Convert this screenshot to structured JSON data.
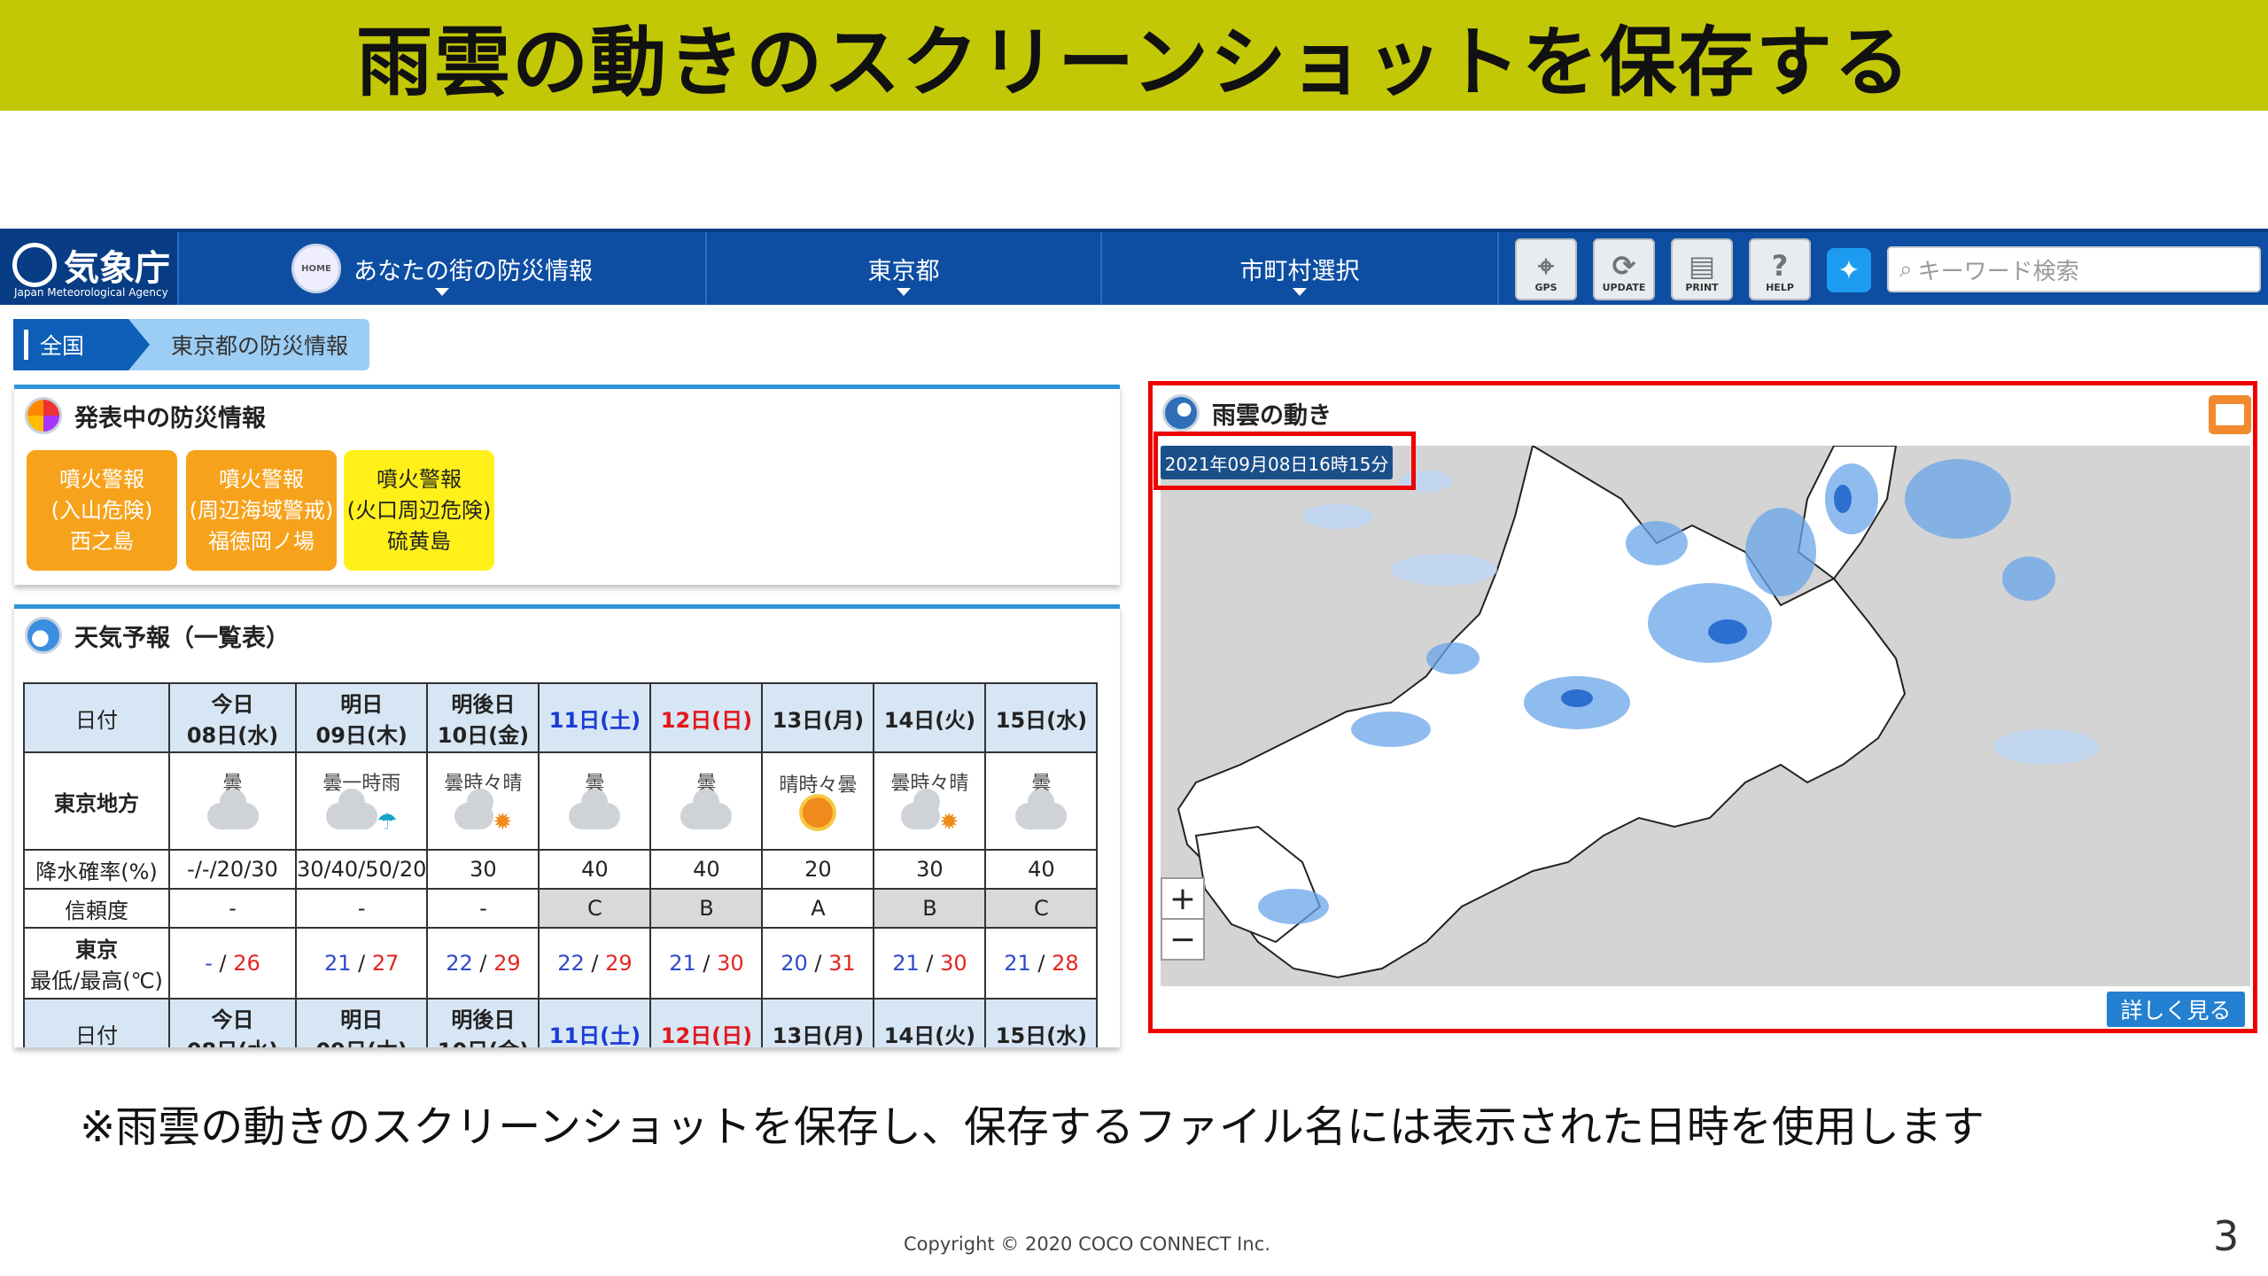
{
  "slide": {
    "title": "雨雲の動きのスクリーンショットを保存する",
    "note": "※雨雲の動きのスクリーンショットを保存し、保存するファイル名には表示された日時を使用します",
    "copyright": "Copyright © 2020 COCO CONNECT Inc.",
    "page_number": "3",
    "title_bg": "#c3c806"
  },
  "header": {
    "logo_jp": "気象庁",
    "logo_en": "Japan Meteorological Agency",
    "home_icon_text": "HOME",
    "nav": [
      "あなたの街の防災情報",
      "東京都",
      "市町村選択"
    ],
    "tools": [
      "GPS",
      "UPDATE",
      "PRINT",
      "HELP"
    ],
    "search_placeholder": "キーワード検索",
    "brand_color": "#0d4ea2"
  },
  "breadcrumb": [
    "全国",
    "東京都の防災情報"
  ],
  "alerts": {
    "title": "発表中の防災情報",
    "items": [
      {
        "line1": "噴火警報",
        "line2": "(入山危険)",
        "line3": "西之島",
        "color": "#f7a21b"
      },
      {
        "line1": "噴火警報",
        "line2": "(周辺海域警戒)",
        "line3": "福徳岡ノ場",
        "color": "#f7a21b"
      },
      {
        "line1": "噴火警報",
        "line2": "(火口周辺危険)",
        "line3": "硫黄島",
        "color": "#fff01a"
      }
    ]
  },
  "forecast": {
    "title": "天気予報（一覧表）",
    "row_labels": {
      "date": "日付",
      "region": "東京地方",
      "precip": "降水確率(%)",
      "reliability": "信頼度",
      "city": "東京",
      "temp": "最低/最高(℃)"
    },
    "days": [
      {
        "line1": "今日",
        "line2": "08日(水)",
        "weather": "曇",
        "icon": "cloud-icon",
        "precip": "-/-/20/30",
        "rel": "-",
        "low": "-",
        "high": "26"
      },
      {
        "line1": "明日",
        "line2": "09日(木)",
        "weather": "曇一時雨",
        "icon": "cloud-rain-icon",
        "precip": "30/40/50/20",
        "rel": "-",
        "low": "21",
        "high": "27"
      },
      {
        "line1": "明後日",
        "line2": "10日(金)",
        "weather": "曇時々晴",
        "icon": "cloud-sun-icon",
        "precip": "30",
        "rel": "-",
        "low": "22",
        "high": "29"
      },
      {
        "line1": "11日(土)",
        "line2": "",
        "weather": "曇",
        "icon": "cloud-icon",
        "precip": "40",
        "rel": "C",
        "low": "22",
        "high": "29"
      },
      {
        "line1": "12日(日)",
        "line2": "",
        "weather": "曇",
        "icon": "cloud-icon",
        "precip": "40",
        "rel": "B",
        "low": "21",
        "high": "30"
      },
      {
        "line1": "13日(月)",
        "line2": "",
        "weather": "晴時々曇",
        "icon": "sun-cloud-icon",
        "precip": "20",
        "rel": "A",
        "low": "20",
        "high": "31"
      },
      {
        "line1": "14日(火)",
        "line2": "",
        "weather": "曇時々晴",
        "icon": "cloud-sun-icon",
        "precip": "30",
        "rel": "B",
        "low": "21",
        "high": "30"
      },
      {
        "line1": "15日(水)",
        "line2": "",
        "weather": "曇",
        "icon": "cloud-icon",
        "precip": "40",
        "rel": "C",
        "low": "21",
        "high": "28"
      }
    ]
  },
  "rain_map": {
    "title": "雨雲の動き",
    "timestamp": "2021年09月08日16時15分",
    "zoom_in": "+",
    "zoom_out": "−",
    "more_label": "詳しく見る",
    "highlight_color": "#e00000"
  }
}
